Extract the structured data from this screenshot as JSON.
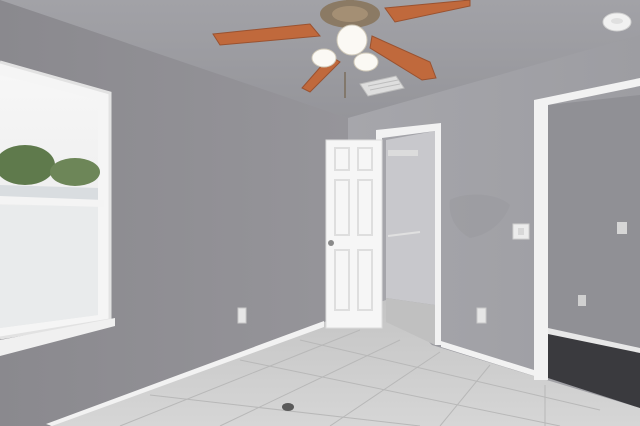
{
  "scene": {
    "description_kind": "photo",
    "room": "empty bedroom",
    "elements": [
      "ceiling-fan",
      "window",
      "closet-door",
      "doorway",
      "tile-floor",
      "outlets",
      "light-switch",
      "ac-vent",
      "smoke-detector"
    ]
  },
  "colors": {
    "wall_left": "#8f8e93",
    "wall_right": "#a3a3a8",
    "ceiling": "#9e9ea3",
    "trim": "#f4f4f4",
    "floor": "#cfcfcf",
    "fan_blade": "#c0693c",
    "fan_metal": "#8b7a64",
    "dark_room_floor": "#3a3a3e"
  }
}
